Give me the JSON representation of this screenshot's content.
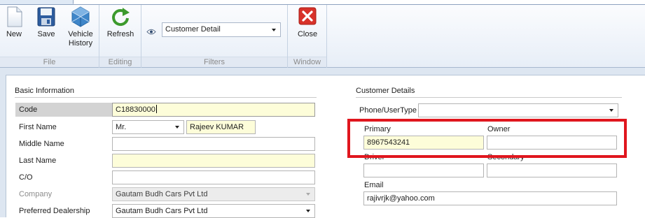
{
  "ribbon": {
    "groups": {
      "file": "File",
      "editing": "Editing",
      "filters": "Filters",
      "window": "Window"
    },
    "buttons": {
      "new": "New",
      "save": "Save",
      "vehicle_history_line1": "Vehicle",
      "vehicle_history_line2": "History",
      "refresh": "Refresh",
      "close": "Close"
    },
    "filter_value": "Customer Detail",
    "icons": [
      "new-document-icon",
      "save-floppy-icon",
      "vehicle-history-icon",
      "refresh-icon",
      "eye-icon",
      "close-icon"
    ]
  },
  "basic_information": {
    "title": "Basic Information",
    "code": {
      "label": "Code",
      "value": "C18830000"
    },
    "first_name": {
      "label": "First Name",
      "salutation": "Mr.",
      "value": "Rajeev KUMAR"
    },
    "middle_name": {
      "label": "Middle Name",
      "value": ""
    },
    "last_name": {
      "label": "Last Name",
      "value": ""
    },
    "care_of": {
      "label": "C/O",
      "value": ""
    },
    "company": {
      "label": "Company",
      "value": "Gautam Budh Cars Pvt Ltd"
    },
    "preferred_dealership": {
      "label": "Preferred Dealership",
      "value": "Gautam Budh Cars Pvt Ltd"
    }
  },
  "customer_details": {
    "title": "Customer Details",
    "phone_user_type": {
      "label": "Phone/UserType",
      "value": ""
    },
    "primary": {
      "label": "Primary",
      "value": "8967543241"
    },
    "owner": {
      "label": "Owner",
      "value": ""
    },
    "driver": {
      "label": "Driver",
      "value": ""
    },
    "secondary": {
      "label": "Secondary",
      "value": ""
    },
    "email": {
      "label": "Email",
      "value": "rajivrjk@yahoo.com"
    }
  },
  "colors": {
    "required_field": "#fdfdd9",
    "highlight": "#e0161e",
    "ribbon_border": "#8da2bf"
  }
}
